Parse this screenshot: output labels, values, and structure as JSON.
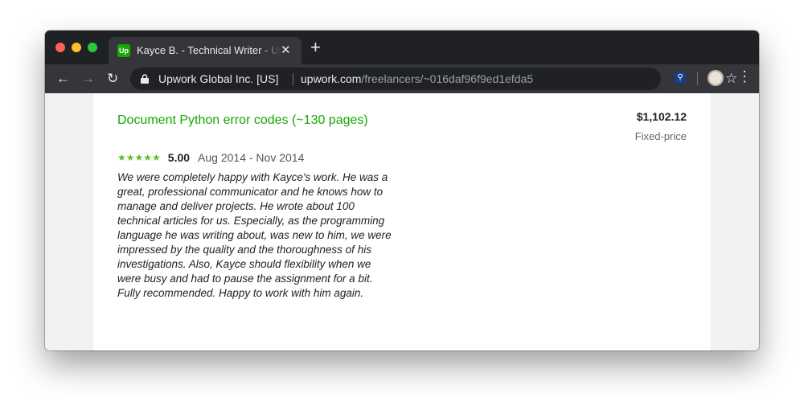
{
  "browser": {
    "tab": {
      "title": "Kayce B. - Technical Writer - Upwork",
      "favicon": "Up"
    },
    "new_tab_icon": "+",
    "close_icon": "✕",
    "omnibox": {
      "site_name": "Upwork Global Inc. [US]",
      "url_host": "upwork.com",
      "url_path": "/freelancers/~016daf96f9ed1efda5"
    }
  },
  "job": {
    "title": "Document Python error codes (~130 pages)",
    "stars": "★★★★★",
    "rating": "5.00",
    "date_range": "Aug 2014 - Nov 2014",
    "feedback": "We were completely happy with Kayce's work. He was a great, professional communicator and he knows how to manage and deliver projects. He wrote about 100 technical articles for us. Especially, as the programming language he was writing about, was new to him, we were impressed by the quality and the thoroughness of his investigations. Also, Kayce should flexibility when we were busy and had to pause the assignment for a bit. Fully recommended. Happy to work with him again.",
    "amount": "$1,102.12",
    "price_type": "Fixed-price"
  },
  "colors": {
    "brand_green": "#14a800",
    "star_green": "#5dbe2a",
    "chrome_dark": "#202124",
    "chrome_toolbar": "#35363a"
  }
}
